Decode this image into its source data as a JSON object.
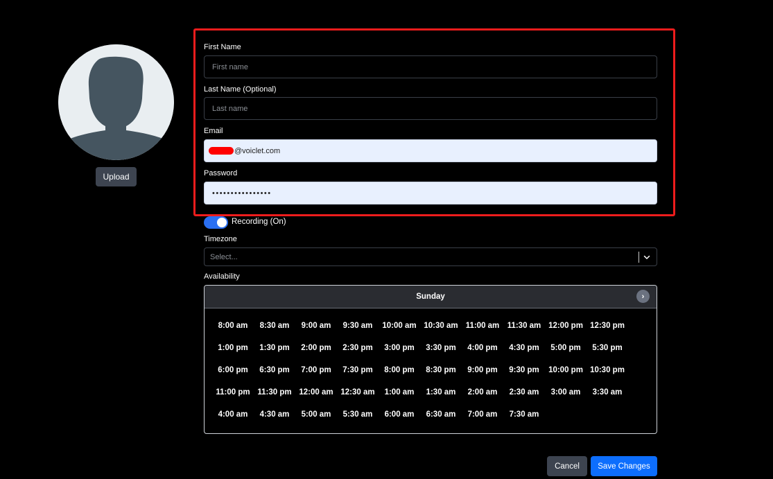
{
  "profile": {
    "upload_label": "Upload"
  },
  "form": {
    "first_name": {
      "label": "First Name",
      "placeholder": "First name"
    },
    "last_name": {
      "label": "Last Name (Optional)",
      "placeholder": "Last name"
    },
    "email": {
      "label": "Email",
      "value": "@voiclet.com"
    },
    "password": {
      "label": "Password",
      "value": "••••••••••••••••"
    },
    "recording": {
      "label": "Recording (On)",
      "on": true
    },
    "timezone": {
      "label": "Timezone",
      "placeholder": "Select..."
    }
  },
  "availability": {
    "label": "Availability",
    "day": "Sunday",
    "next_glyph": "›",
    "slots": [
      "8:00 am",
      "8:30 am",
      "9:00 am",
      "9:30 am",
      "10:00 am",
      "10:30 am",
      "11:00 am",
      "11:30 am",
      "12:00 pm",
      "12:30 pm",
      "1:00 pm",
      "1:30 pm",
      "2:00 pm",
      "2:30 pm",
      "3:00 pm",
      "3:30 pm",
      "4:00 pm",
      "4:30 pm",
      "5:00 pm",
      "5:30 pm",
      "6:00 pm",
      "6:30 pm",
      "7:00 pm",
      "7:30 pm",
      "8:00 pm",
      "8:30 pm",
      "9:00 pm",
      "9:30 pm",
      "10:00 pm",
      "10:30 pm",
      "11:00 pm",
      "11:30 pm",
      "12:00 am",
      "12:30 am",
      "1:00 am",
      "1:30 am",
      "2:00 am",
      "2:30 am",
      "3:00 am",
      "3:30 am",
      "4:00 am",
      "4:30 am",
      "5:00 am",
      "5:30 am",
      "6:00 am",
      "6:30 am",
      "7:00 am",
      "7:30 am"
    ]
  },
  "actions": {
    "cancel_label": "Cancel",
    "save_label": "Save Changes"
  },
  "colors": {
    "background": "#000000",
    "highlight": "#ee1c1c",
    "primary": "#0d6efd",
    "toggle": "#2a6ff2",
    "secondary_button": "#3d4450"
  }
}
